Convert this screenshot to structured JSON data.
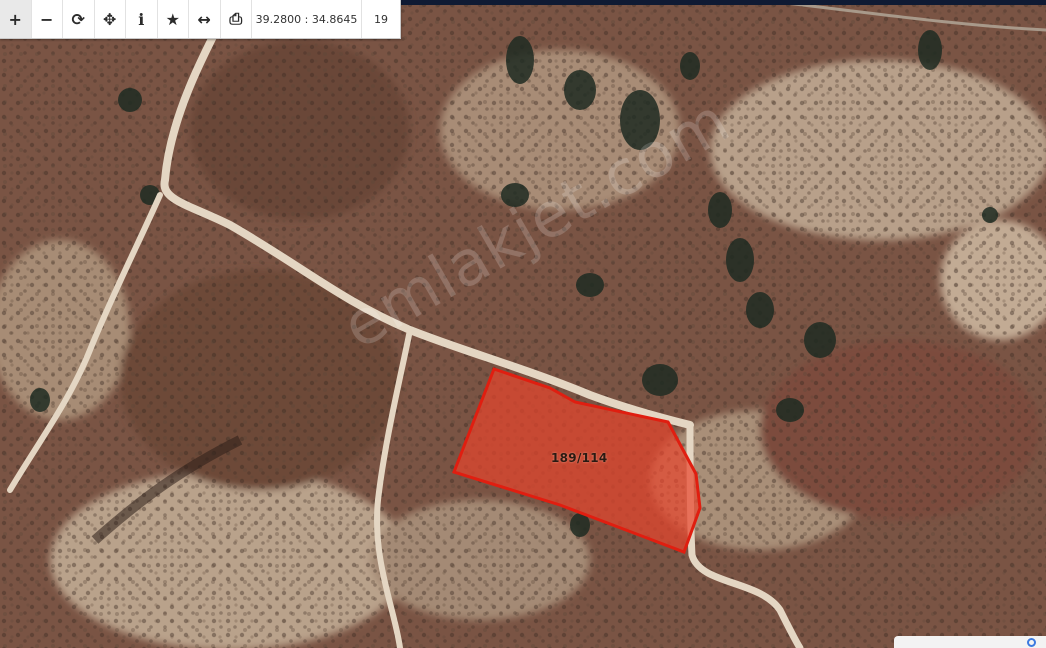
{
  "toolbar": {
    "buttons": [
      {
        "name": "zoom-in",
        "glyph": "+"
      },
      {
        "name": "zoom-out",
        "glyph": "−"
      },
      {
        "name": "refresh",
        "glyph": "⟳"
      },
      {
        "name": "locate",
        "glyph": "✥"
      },
      {
        "name": "info",
        "glyph": "i"
      },
      {
        "name": "favorite",
        "glyph": "★"
      },
      {
        "name": "measure",
        "glyph": "↔"
      },
      {
        "name": "print",
        "glyph": "⎙"
      }
    ],
    "coordinates": "39.2800 : 34.8645",
    "zoom_level": "19"
  },
  "parcel": {
    "label": "189/114",
    "fill_color": "#e8452c",
    "stroke_color": "#e01e10"
  },
  "watermark": {
    "text": "emlakjet.com"
  },
  "colors": {
    "soil_dark": "#6b4535",
    "soil_mid": "#8b6250",
    "soil_light": "#b89a82",
    "road": "#e6d8c6",
    "tree": "#2e3a2a"
  }
}
